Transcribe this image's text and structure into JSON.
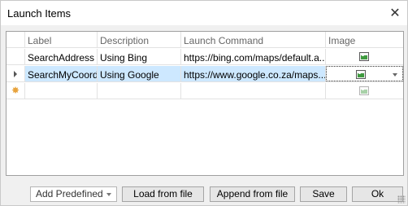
{
  "window": {
    "title": "Launch Items",
    "close_glyph": "✕"
  },
  "grid": {
    "columns": [
      "Label",
      "Description",
      "Launch Command",
      "Image"
    ],
    "rows": [
      {
        "label": "SearchAddress",
        "description": "Using Bing",
        "command": "https://bing.com/maps/default.a...",
        "image_icon": "image-icon"
      },
      {
        "label": "SearchMyCoords",
        "description": "Using Google",
        "command": "https://www.google.co.za/maps...",
        "image_icon": "image-icon",
        "selected": true
      },
      {
        "label": "",
        "description": "",
        "command": "",
        "image_icon": "image-icon",
        "new_row": true
      }
    ],
    "new_row_glyph": "✸"
  },
  "footer": {
    "add_predefined": "Add Predefined",
    "load_from_file": "Load from file",
    "append_from_file": "Append from file",
    "save": "Save",
    "ok": "Ok"
  },
  "colors": {
    "selection": "#cde8ff",
    "new_row_marker": "#e8a33c"
  }
}
